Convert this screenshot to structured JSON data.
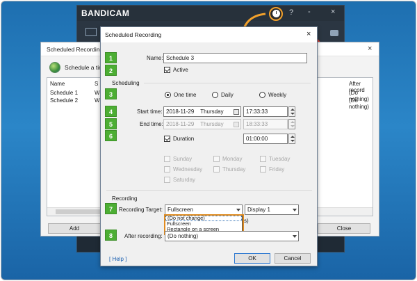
{
  "colors": {
    "accent_orange": "#f2a12b",
    "badge_green": "#4cae33",
    "desktop_blue": "#2b86c8",
    "record_red": "#d33b32"
  },
  "bandicam": {
    "brand": "BANDICAM",
    "window_buttons": [
      "?",
      "-",
      "×"
    ],
    "icons": [
      "clock-icon",
      "record-button-icon",
      "camera-icon",
      "screen-mode-icon"
    ]
  },
  "list_window": {
    "title": "Scheduled Recording Lis",
    "schedule_label": "Schedule a tim",
    "columns": [
      "Name",
      "S",
      "After record"
    ],
    "rows": [
      {
        "name": "Schedule 1",
        "s": "W",
        "after": "(Do nothing)"
      },
      {
        "name": "Schedule 2",
        "s": "W",
        "after": "(Do nothing)"
      }
    ],
    "add_label": "Add",
    "close_label": "Close"
  },
  "dialog": {
    "title": "Scheduled Recording",
    "badges": [
      "1",
      "2",
      "3",
      "4",
      "5",
      "6",
      "7",
      "8"
    ],
    "name_label": "Name:",
    "name_value": "Schedule 3",
    "active_label": "Active",
    "active_checked": true,
    "scheduling_label": "Scheduling",
    "freq_options": [
      {
        "label": "One time",
        "selected": true
      },
      {
        "label": "Daily",
        "selected": false
      },
      {
        "label": "Weekly",
        "selected": false
      }
    ],
    "start_time_label": "Start time:",
    "start_date": "2018-11-29",
    "start_day": "Thursday",
    "start_clock": "17:33:33",
    "end_time_label": "End time:",
    "end_date": "2018-11-29",
    "end_day": "Thursday",
    "end_clock": "18:33:33",
    "duration_label": "Duration",
    "duration_checked": true,
    "duration_value": "01:00:00",
    "days": [
      "Sunday",
      "Monday",
      "Tuesday",
      "Wednesday",
      "Thursday",
      "Friday",
      "Saturday"
    ],
    "recording_label": "Recording",
    "target_label": "Recording Target:",
    "target_value": "Fullscreen",
    "display_value": "Display 1",
    "target_options": [
      "(Do not change)",
      "Fullscreen",
      "Rectangle on a screen"
    ],
    "partial_text": "s)",
    "after_label": "After recording:",
    "after_value": "(Do nothing)",
    "help_label": "[ Help ]",
    "ok_label": "OK",
    "cancel_label": "Cancel"
  }
}
